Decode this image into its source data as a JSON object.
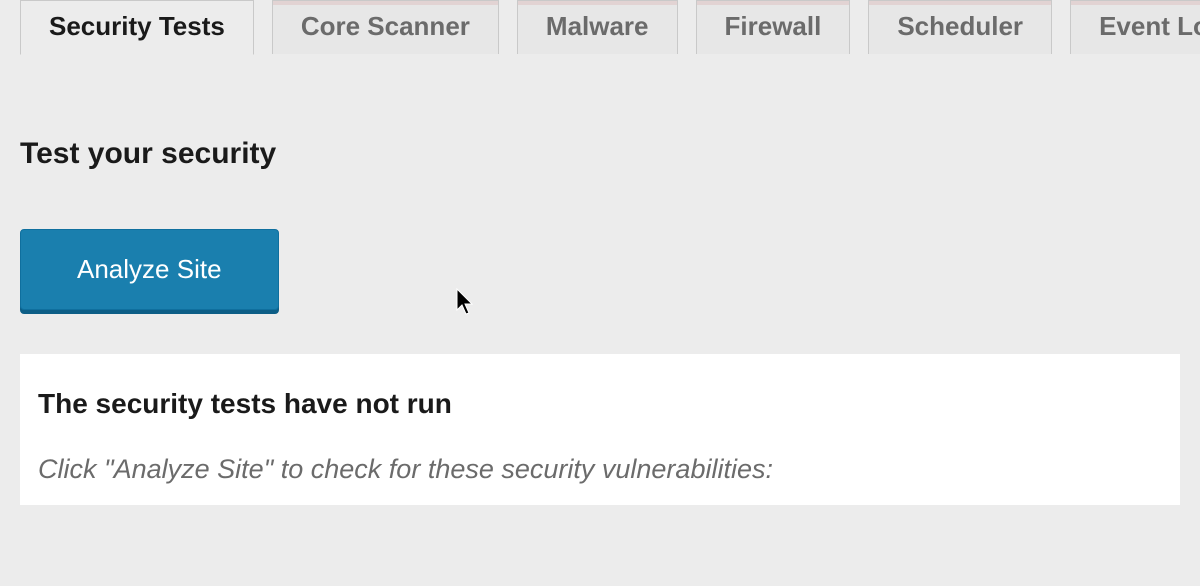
{
  "tabs": [
    {
      "label": "Security Tests",
      "active": true
    },
    {
      "label": "Core Scanner",
      "active": false
    },
    {
      "label": "Malware",
      "active": false
    },
    {
      "label": "Firewall",
      "active": false
    },
    {
      "label": "Scheduler",
      "active": false
    },
    {
      "label": "Event Log",
      "active": false
    }
  ],
  "main": {
    "section_title": "Test your security",
    "analyze_button": "Analyze Site"
  },
  "panel": {
    "heading": "The security tests have not run",
    "subtext": "Click \"Analyze Site\" to check for these security vulnerabilities:"
  }
}
